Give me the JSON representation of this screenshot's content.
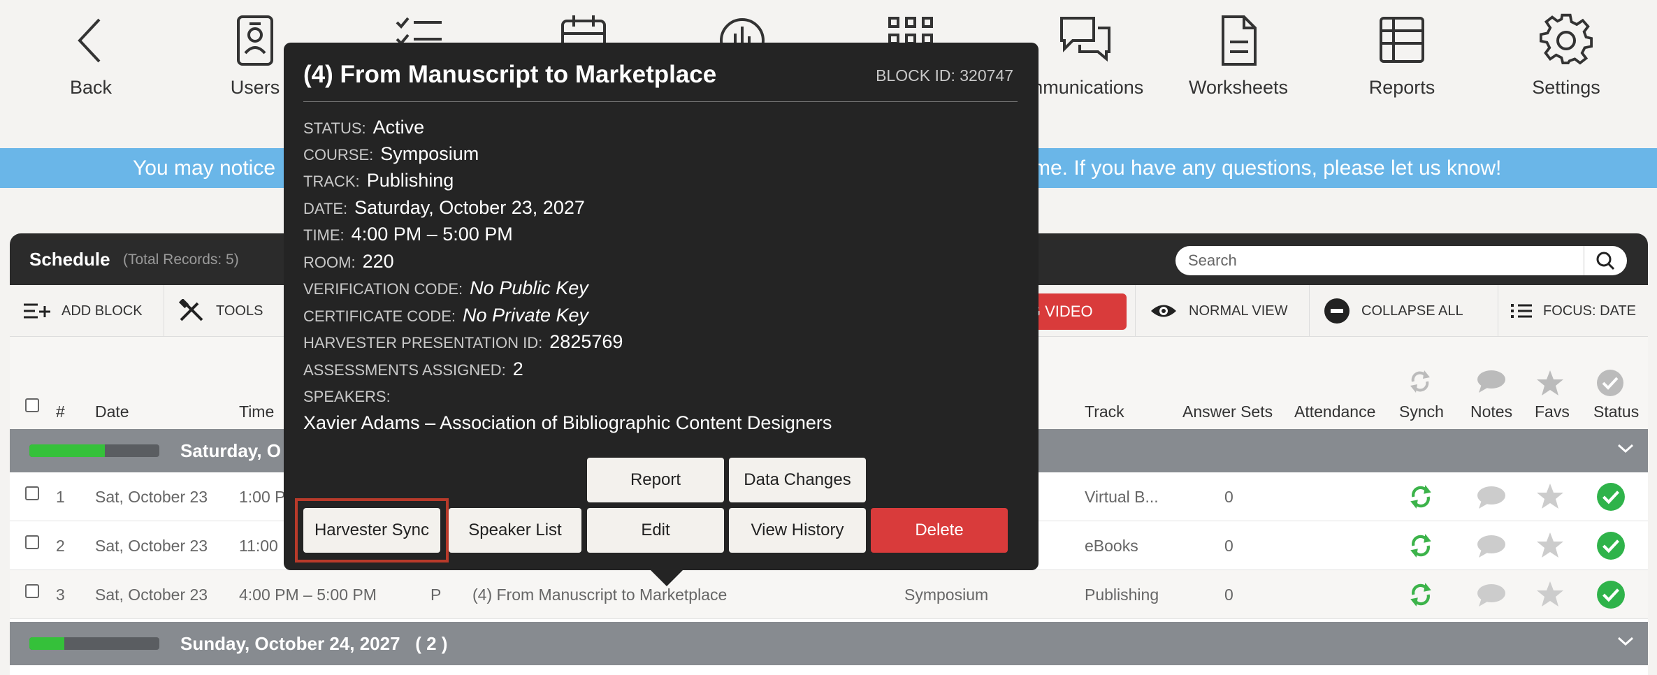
{
  "nav": {
    "items": [
      {
        "label": "Back",
        "icon": "back-chevron-icon"
      },
      {
        "label": "Users",
        "icon": "user-badge-icon"
      },
      {
        "label": "",
        "icon": "checklist-icon"
      },
      {
        "label": "",
        "icon": "calendar-icon"
      },
      {
        "label": "",
        "icon": "chart-circle-icon"
      },
      {
        "label": "",
        "icon": "grid-icon"
      },
      {
        "label": "mmunications",
        "icon": "chat-bubbles-icon"
      },
      {
        "label": "Worksheets",
        "icon": "document-icon"
      },
      {
        "label": "Reports",
        "icon": "table-icon"
      },
      {
        "label": "Settings",
        "icon": "gear-icon"
      }
    ]
  },
  "banner": {
    "left_text": "You may notice",
    "right_text": "me. If you have any questions, please let us know!",
    "color": "#6ab6e8"
  },
  "schedule": {
    "title": "Schedule",
    "total": "(Total Records: 5)",
    "search_placeholder": "Search"
  },
  "toolbar": {
    "add_block": "ADD BLOCK",
    "tools": "TOOLS",
    "live_video": "NG VIDEO",
    "normal_view": "NORMAL VIEW",
    "collapse_all": "COLLAPSE ALL",
    "focus_date": "FOCUS: DATE"
  },
  "columns": {
    "num": "#",
    "date": "Date",
    "time": "Time",
    "track": "Track",
    "answer_sets": "Answer Sets",
    "attendance": "Attendance",
    "synch": "Synch",
    "notes": "Notes",
    "favs": "Favs",
    "status": "Status"
  },
  "groups": [
    {
      "label": "Saturday, O",
      "progress": 0.58
    },
    {
      "label": "Sunday, October 24, 2027   ( 2 )",
      "progress": 0.27
    }
  ],
  "rows": [
    {
      "num": "1",
      "date": "Sat, October 23",
      "time": "1:00 P",
      "type": "",
      "title": "",
      "course": "",
      "track": "Virtual B...",
      "answers": "0"
    },
    {
      "num": "2",
      "date": "Sat, October 23",
      "time": "11:00",
      "type": "",
      "title": "",
      "course": "",
      "track": "eBooks",
      "answers": "0"
    },
    {
      "num": "3",
      "date": "Sat, October 23",
      "time": "4:00 PM – 5:00 PM",
      "type": "P",
      "title": "(4) From Manuscript to Marketplace",
      "course": "Symposium",
      "track": "Publishing",
      "answers": "0"
    }
  ],
  "popup": {
    "title": "(4) From Manuscript to Marketplace",
    "block_id": "BLOCK ID: 320747",
    "fields": {
      "status_k": "STATUS:",
      "status_v": "Active",
      "course_k": "COURSE:",
      "course_v": "Symposium",
      "track_k": "TRACK:",
      "track_v": "Publishing",
      "date_k": "DATE:",
      "date_v": "Saturday, October 23, 2027",
      "time_k": "TIME:",
      "time_v": "4:00 PM – 5:00 PM",
      "room_k": "ROOM:",
      "room_v": "220",
      "verif_k": "VERIFICATION CODE:",
      "verif_v": "No Public Key",
      "cert_k": "CERTIFICATE CODE:",
      "cert_v": "No Private Key",
      "harv_k": "HARVESTER PRESENTATION ID:",
      "harv_v": "2825769",
      "assess_k": "ASSESSMENTS ASSIGNED:",
      "assess_v": "2",
      "speakers_k": "SPEAKERS:",
      "speakers_v": "Xavier Adams – Association of Bibliographic Content Designers"
    },
    "buttons": {
      "report": "Report",
      "data_changes": "Data Changes",
      "harvester_sync": "Harvester Sync",
      "speaker_list": "Speaker List",
      "edit": "Edit",
      "view_history": "View History",
      "delete": "Delete"
    }
  },
  "colors": {
    "accent_blue": "#6ab6e8",
    "delete_red": "#d93b3b",
    "status_green": "#2fb34a",
    "highlight": "#b83a2a"
  }
}
